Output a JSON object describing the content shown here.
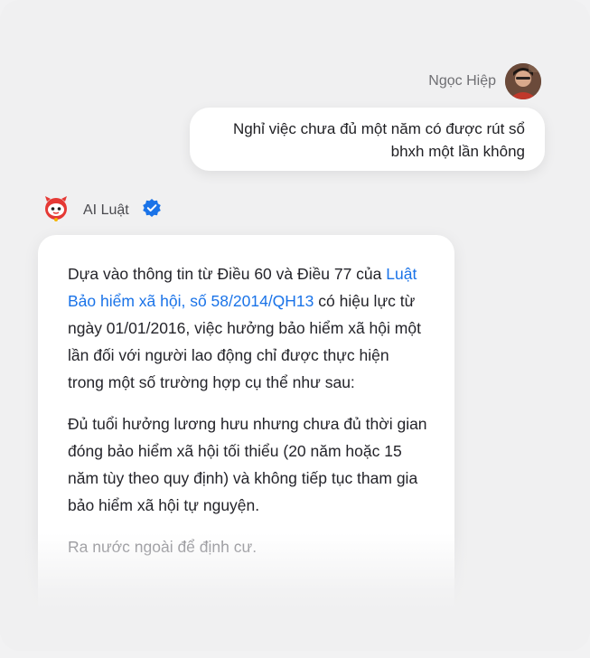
{
  "user": {
    "name": "Ngọc Hiệp",
    "message": "Nghỉ việc chưa đủ một năm có được rút sổ bhxh một lần không"
  },
  "bot": {
    "name": "AI Luật",
    "verified_icon": "check-badge-icon",
    "response": {
      "p1_before": "Dựa vào thông tin từ Điều 60 và Điều 77 của ",
      "p1_link": "Luật Bảo hiểm xã hội, số 58/2014/QH13",
      "p1_after": " có hiệu lực từ ngày 01/01/2016, việc hưởng bảo hiểm xã hội một lần đối với người lao động chỉ được thực hiện trong một số trường hợp cụ thể như sau:",
      "p2": "Đủ tuổi hưởng lương hưu nhưng chưa đủ thời gian đóng bảo hiểm xã hội tối thiểu (20 năm hoặc 15 năm tùy theo quy định) và không tiếp tục tham gia bảo hiểm xã hội tự nguyện.",
      "p3": "Ra nước ngoài để định cư."
    }
  },
  "colors": {
    "link": "#1a73e8",
    "verified": "#1a73e8",
    "bot_avatar": "#e53935"
  }
}
